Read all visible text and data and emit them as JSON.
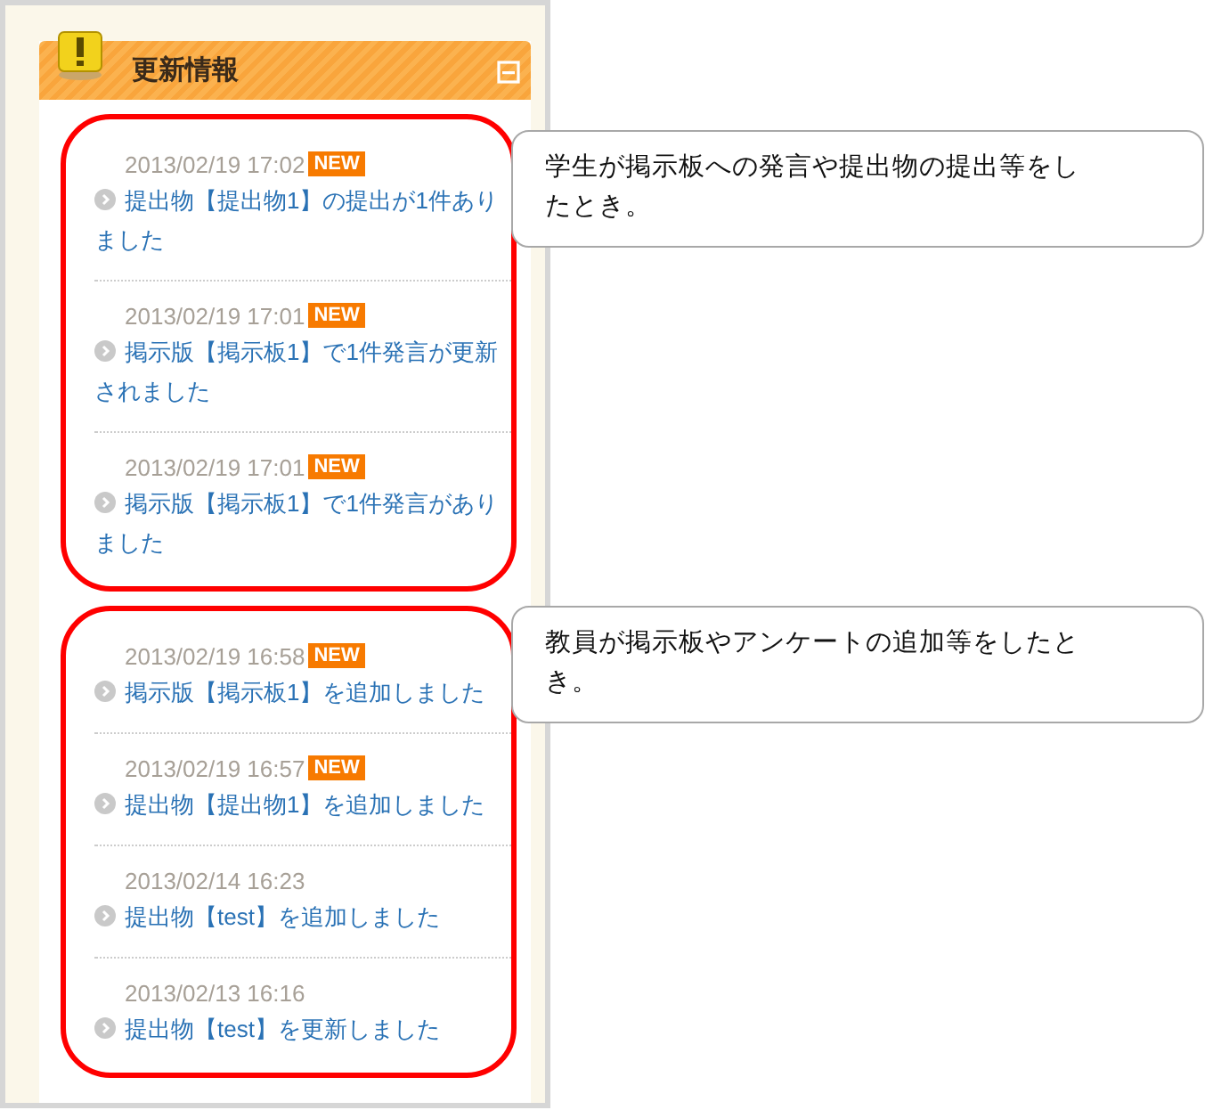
{
  "panel": {
    "title": "更新情報"
  },
  "groups": [
    {
      "note": "学生が掲示板への発言や提出物の提出等をしたとき。",
      "items": [
        {
          "date": "2013/02/19 17:02",
          "badge": "NEW",
          "text": "提出物【提出物1】の提出が1件ありました"
        },
        {
          "date": "2013/02/19 17:01",
          "badge": "NEW",
          "text": "掲示版【掲示板1】で1件発言が更新されました"
        },
        {
          "date": "2013/02/19 17:01",
          "badge": "NEW",
          "text": "掲示版【掲示板1】で1件発言がありました"
        }
      ]
    },
    {
      "note": "教員が掲示板やアンケートの追加等をしたとき。",
      "items": [
        {
          "date": "2013/02/19 16:58",
          "badge": "NEW",
          "text": "掲示版【掲示板1】を追加しました"
        },
        {
          "date": "2013/02/19 16:57",
          "badge": "NEW",
          "text": "提出物【提出物1】を追加しました"
        },
        {
          "date": "2013/02/14 16:23",
          "text": "提出物【test】を追加しました"
        },
        {
          "date": "2013/02/13 16:16",
          "text": "提出物【test】を更新しました"
        }
      ]
    }
  ]
}
